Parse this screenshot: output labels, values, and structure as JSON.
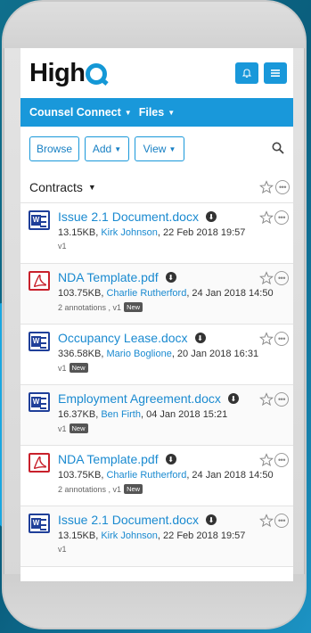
{
  "header": {
    "logo_text": "High",
    "logo_letter": "Q",
    "brand_color": "#1998da"
  },
  "nav": {
    "site": "Counsel Connect",
    "section": "Files"
  },
  "toolbar": {
    "browse": "Browse",
    "add": "Add",
    "view": "View"
  },
  "folder": {
    "name": "Contracts"
  },
  "files": [
    {
      "name": "Issue 2.1 Document.docx",
      "type": "word",
      "size": "13.15KB, ",
      "author": "Kirk Johnson",
      "date": ", 22 Feb 2018 19:57",
      "sub": "v1",
      "is_new": false
    },
    {
      "name": "NDA Template.pdf",
      "type": "pdf",
      "size": "103.75KB, ",
      "author": "Charlie Rutherford",
      "date": ", 24 Jan 2018 14:50",
      "sub": "2 annotations , v1",
      "is_new": true
    },
    {
      "name": "Occupancy Lease.docx",
      "type": "word",
      "size": "336.58KB, ",
      "author": "Mario Boglione",
      "date": ", 20 Jan 2018 16:31",
      "sub": "v1",
      "is_new": true
    },
    {
      "name": "Employment Agreement.docx",
      "type": "word",
      "size": "16.37KB, ",
      "author": "Ben Firth",
      "date": ", 04 Jan 2018 15:21",
      "sub": "v1",
      "is_new": true
    },
    {
      "name": "NDA Template.pdf",
      "type": "pdf",
      "size": "103.75KB, ",
      "author": "Charlie Rutherford",
      "date": ", 24 Jan 2018 14:50",
      "sub": "2 annotations , v1",
      "is_new": true
    },
    {
      "name": "Issue 2.1 Document.docx",
      "type": "word",
      "size": "13.15KB, ",
      "author": "Kirk Johnson",
      "date": ", 22 Feb 2018 19:57",
      "sub": "v1",
      "is_new": false
    }
  ],
  "badge_label": "New"
}
